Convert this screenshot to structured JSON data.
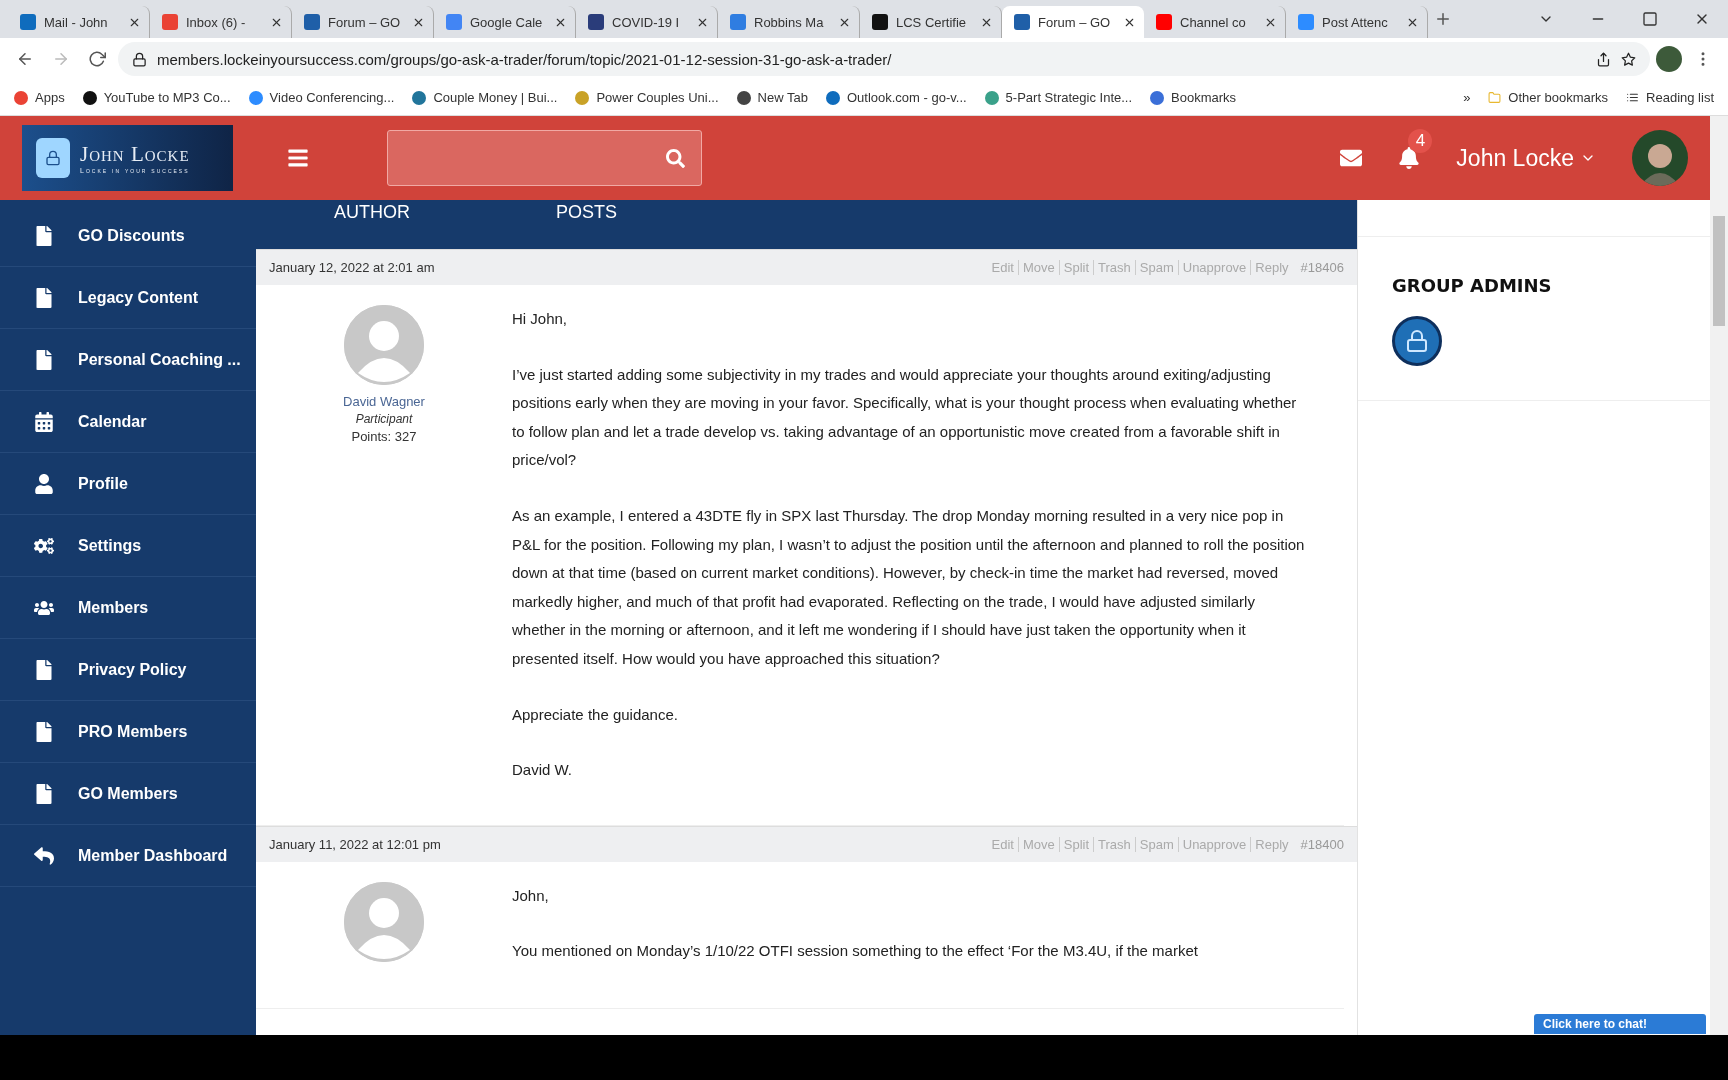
{
  "browser": {
    "tabs": [
      {
        "title": "Mail - John",
        "color": "#0f6cbd",
        "selected": false
      },
      {
        "title": "Inbox (6) - ",
        "color": "#ea4335",
        "selected": false
      },
      {
        "title": "Forum – GO",
        "color": "#1f5fa8",
        "selected": false
      },
      {
        "title": "Google Cale",
        "color": "#4285f4",
        "selected": false
      },
      {
        "title": "COVID-19 I",
        "color": "#2a3c7a",
        "selected": false
      },
      {
        "title": "Robbins Ma",
        "color": "#2f7de1",
        "selected": false
      },
      {
        "title": "LCS Certifie",
        "color": "#111111",
        "selected": false
      },
      {
        "title": "Forum – GO",
        "color": "#1f5fa8",
        "selected": true
      },
      {
        "title": "Channel co",
        "color": "#ff0000",
        "selected": false
      },
      {
        "title": "Post Attenc",
        "color": "#2d8cff",
        "selected": false
      }
    ],
    "url": "members.lockeinyoursuccess.com/groups/go-ask-a-trader/forum/topic/2021-01-12-session-31-go-ask-a-trader/",
    "bookmarks": [
      {
        "label": "Apps",
        "color": "#ea4335"
      },
      {
        "label": "YouTube to MP3 Co...",
        "color": "#111111"
      },
      {
        "label": "Video Conferencing...",
        "color": "#2d8cff"
      },
      {
        "label": "Couple Money | Bui...",
        "color": "#21759b"
      },
      {
        "label": "Power Couples Uni...",
        "color": "#c9a227"
      },
      {
        "label": "New Tab",
        "color": "#444444"
      },
      {
        "label": "Outlook.com - go-v...",
        "color": "#0f6cbd"
      },
      {
        "label": "5-Part Strategic Inte...",
        "color": "#3aa18a"
      },
      {
        "label": "Bookmarks",
        "color": "#3b6fd8"
      }
    ],
    "more": "»",
    "other_bookmarks": "Other bookmarks",
    "reading_list": "Reading list"
  },
  "header": {
    "logo": {
      "name": "John Locke",
      "tagline": "Locke in your success"
    },
    "notifications": "4",
    "user": "John Locke"
  },
  "sidebar": {
    "items": [
      {
        "label": "GO Discounts",
        "kind": "page"
      },
      {
        "label": "Legacy Content",
        "kind": "page"
      },
      {
        "label": "Personal Coaching ...",
        "kind": "page"
      },
      {
        "label": "Calendar",
        "kind": "calendar"
      },
      {
        "label": "Profile",
        "kind": "user"
      },
      {
        "label": "Settings",
        "kind": "gears"
      },
      {
        "label": "Members",
        "kind": "users"
      },
      {
        "label": "Privacy Policy",
        "kind": "page"
      },
      {
        "label": "PRO Members",
        "kind": "page"
      },
      {
        "label": "GO Members",
        "kind": "page"
      },
      {
        "label": "Member Dashboard",
        "kind": "back"
      }
    ]
  },
  "table_header": {
    "column_1": "AUTHOR",
    "column_2": "POSTS"
  },
  "posts": [
    {
      "date": "January 12, 2022 at 2:01 am",
      "actions": [
        "Edit",
        "Move",
        "Split",
        "Trash",
        "Spam",
        "Unapprove",
        "Reply"
      ],
      "id": "#18406",
      "author": "David Wagner",
      "role": "Participant",
      "points": "Points: 327",
      "paragraphs": [
        "Hi John,",
        "I’ve just started adding some subjectivity in my trades and would appreciate your thoughts around exiting/adjusting positions early when they are moving in your favor. Specifically, what is your thought process when evaluating whether to follow plan and let a trade develop vs. taking advantage of an opportunistic move created from a favorable shift in price/vol?",
        "As an example, I entered a 43DTE fly in SPX last Thursday. The drop Monday morning resulted in a very nice pop in P&L for the position.  Following my plan, I wasn’t to adjust the position until the afternoon and planned to roll the position down at that time (based on current market conditions). However, by check-in time the market had reversed, moved markedly higher, and much of that profit had evaporated.  Reflecting on the trade, I would have adjusted similarly whether in the morning or afternoon, and it left me wondering if I should have just taken the opportunity when it presented itself. How would you have approached this situation?",
        "Appreciate the guidance.",
        "David W."
      ]
    },
    {
      "date": "January 11, 2022 at 12:01 pm",
      "actions": [
        "Edit",
        "Move",
        "Split",
        "Trash",
        "Spam",
        "Unapprove",
        "Reply"
      ],
      "id": "#18400",
      "paragraphs": [
        "John,",
        "You mentioned on Monday’s 1/10/22 OTFI session something to the effect ‘For the M3.4U, if the market"
      ]
    }
  ],
  "group_admins": {
    "title": "GROUP ADMINS"
  },
  "chat": "Click here to chat!"
}
